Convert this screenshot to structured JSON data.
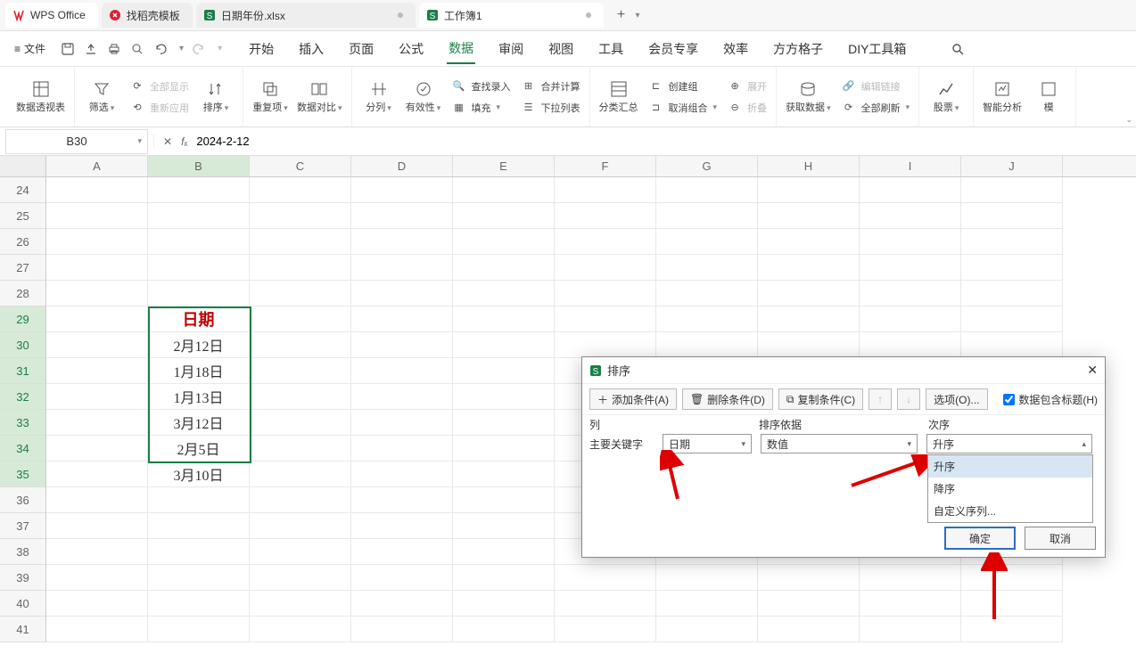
{
  "tabs": {
    "app": "WPS Office",
    "template": "找稻壳模板",
    "file1": "日期年份.xlsx",
    "file2": "工作簿1"
  },
  "menubar": {
    "file": "文件",
    "items": [
      "开始",
      "插入",
      "页面",
      "公式",
      "数据",
      "审阅",
      "视图",
      "工具",
      "会员专享",
      "效率",
      "方方格子",
      "DIY工具箱"
    ]
  },
  "ribbon": {
    "pivot": "数据透视表",
    "filter": "筛选",
    "showall": "全部显示",
    "reapply": "重新应用",
    "sort": "排序",
    "dup": "重复项",
    "compare": "数据对比",
    "split": "分列",
    "valid": "有效性",
    "insertdd": "下拉列表",
    "lookup": "查找录入",
    "merge": "合并计算",
    "fill": "填充",
    "subtotal": "分类汇总",
    "group": "创建组",
    "ungroup": "取消组合",
    "expand": "展开",
    "collapse": "折叠",
    "getdata": "获取数据",
    "refresh": "全部刷新",
    "editlink": "编辑链接",
    "stock": "股票",
    "smart": "智能分析",
    "template": "模"
  },
  "namebox": "B30",
  "formula": "2024-2-12",
  "columns": [
    "A",
    "B",
    "C",
    "D",
    "E",
    "F",
    "G",
    "H",
    "I",
    "J"
  ],
  "rows": [
    "24",
    "25",
    "26",
    "27",
    "28",
    "29",
    "30",
    "31",
    "32",
    "33",
    "34",
    "35",
    "36",
    "37",
    "38",
    "39",
    "40",
    "41"
  ],
  "sheet": {
    "header": "日期",
    "data": [
      "2月12日",
      "1月18日",
      "1月13日",
      "3月12日",
      "2月5日",
      "3月10日"
    ]
  },
  "dialog": {
    "title": "排序",
    "add": "添加条件(A)",
    "del": "删除条件(D)",
    "copy": "复制条件(C)",
    "options": "选项(O)...",
    "hasHeader": "数据包含标题(H)",
    "colHdr": "列",
    "byHdr": "排序依据",
    "orderHdr": "次序",
    "primary": "主要关键字",
    "colVal": "日期",
    "byVal": "数值",
    "orderVal": "升序",
    "opts": [
      "升序",
      "降序",
      "自定义序列..."
    ],
    "ok": "确定",
    "cancel": "取消"
  }
}
